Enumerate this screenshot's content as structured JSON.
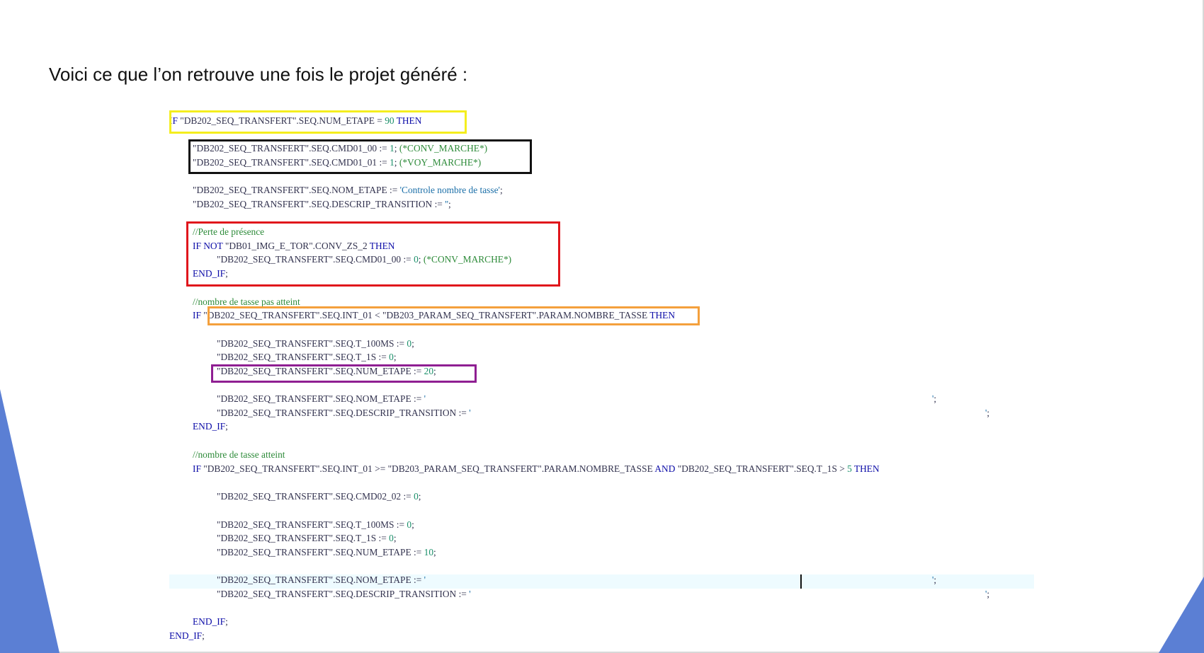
{
  "slide": {
    "intro_text": "Voici ce que l’on retrouve une fois le projet généré :",
    "highlight_colors": {
      "yellow": "#f4ee1e",
      "black": "#111111",
      "red": "#e0161c",
      "orange": "#f4a03c",
      "purple": "#8f1f92"
    },
    "accent_color": "#5b7fd4"
  },
  "code": {
    "lines": [
      {
        "id": "l1",
        "x": 0,
        "y": 0,
        "segments": [
          {
            "t": "IF",
            "c": "kw"
          },
          {
            "t": " \"DB202_SEQ_TRANSFERT\".SEQ.NUM_ETAPE = "
          },
          {
            "t": "90",
            "c": "num"
          },
          {
            "t": " "
          },
          {
            "t": "THEN",
            "c": "kw"
          }
        ]
      },
      {
        "id": "l2",
        "segments": [
          {
            "t": "\"DB202_SEQ_TRANSFERT\".SEQ.CMD01_00 := "
          },
          {
            "t": "1",
            "c": "num"
          },
          {
            "t": "; "
          },
          {
            "t": "(*CONV_MARCHE*)",
            "c": "cmt"
          }
        ]
      },
      {
        "id": "l3",
        "segments": [
          {
            "t": "\"DB202_SEQ_TRANSFERT\".SEQ.CMD01_01 := "
          },
          {
            "t": "1",
            "c": "num"
          },
          {
            "t": "; "
          },
          {
            "t": "(*VOY_MARCHE*)",
            "c": "cmt"
          }
        ]
      },
      {
        "id": "l4",
        "segments": [
          {
            "t": "\"DB202_SEQ_TRANSFERT\".SEQ.NOM_ETAPE := "
          },
          {
            "t": "'Controle nombre de tasse'",
            "c": "str"
          },
          {
            "t": ";"
          }
        ]
      },
      {
        "id": "l5",
        "segments": [
          {
            "t": "\"DB202_SEQ_TRANSFERT\".SEQ.DESCRIP_TRANSITION := "
          },
          {
            "t": "''",
            "c": "str"
          },
          {
            "t": ";"
          }
        ]
      },
      {
        "id": "l6",
        "segments": [
          {
            "t": "//Perte de présence",
            "c": "cmt"
          }
        ]
      },
      {
        "id": "l7",
        "segments": [
          {
            "t": "IF NOT",
            "c": "kw"
          },
          {
            "t": " \"DB01_IMG_E_TOR\".CONV_ZS_2 "
          },
          {
            "t": "THEN",
            "c": "kw"
          }
        ]
      },
      {
        "id": "l8",
        "segments": [
          {
            "t": "\"DB202_SEQ_TRANSFERT\".SEQ.CMD01_00 := "
          },
          {
            "t": "0",
            "c": "num"
          },
          {
            "t": "; "
          },
          {
            "t": "(*CONV_MARCHE*)",
            "c": "cmt"
          }
        ]
      },
      {
        "id": "l9",
        "segments": [
          {
            "t": "END_IF",
            "c": "kw"
          },
          {
            "t": ";"
          }
        ]
      },
      {
        "id": "l10",
        "segments": [
          {
            "t": "//nombre de tasse pas atteint",
            "c": "cmt"
          }
        ]
      },
      {
        "id": "l11",
        "segments": [
          {
            "t": "IF",
            "c": "kw"
          },
          {
            "t": " \"DB202_SEQ_TRANSFERT\".SEQ.INT_01 < \"DB203_PARAM_SEQ_TRANSFERT\".PARAM.NOMBRE_TASSE "
          },
          {
            "t": "THEN",
            "c": "kw"
          }
        ]
      },
      {
        "id": "l12",
        "segments": [
          {
            "t": "\"DB202_SEQ_TRANSFERT\".SEQ.T_100MS := "
          },
          {
            "t": "0",
            "c": "num"
          },
          {
            "t": ";"
          }
        ]
      },
      {
        "id": "l13",
        "segments": [
          {
            "t": "\"DB202_SEQ_TRANSFERT\".SEQ.T_1S := "
          },
          {
            "t": "0",
            "c": "num"
          },
          {
            "t": ";"
          }
        ]
      },
      {
        "id": "l14",
        "segments": [
          {
            "t": "\"DB202_SEQ_TRANSFERT\".SEQ.NUM_ETAPE := "
          },
          {
            "t": "20",
            "c": "num"
          },
          {
            "t": ";"
          }
        ]
      },
      {
        "id": "l15",
        "segments": [
          {
            "t": "\"DB202_SEQ_TRANSFERT\".SEQ.NOM_ETAPE := "
          },
          {
            "t": "'",
            "c": "str"
          }
        ]
      },
      {
        "id": "l15b",
        "segments": [
          {
            "t": "'",
            "c": "str"
          },
          {
            "t": ";"
          }
        ]
      },
      {
        "id": "l16",
        "segments": [
          {
            "t": "\"DB202_SEQ_TRANSFERT\".SEQ.DESCRIP_TRANSITION := "
          },
          {
            "t": "'",
            "c": "str"
          }
        ]
      },
      {
        "id": "l16b",
        "segments": [
          {
            "t": "'",
            "c": "str"
          },
          {
            "t": ";"
          }
        ]
      },
      {
        "id": "l17",
        "segments": [
          {
            "t": "END_IF",
            "c": "kw"
          },
          {
            "t": ";"
          }
        ]
      },
      {
        "id": "l18",
        "segments": [
          {
            "t": "//nombre de tasse atteint",
            "c": "cmt"
          }
        ]
      },
      {
        "id": "l19",
        "segments": [
          {
            "t": "IF",
            "c": "kw"
          },
          {
            "t": " \"DB202_SEQ_TRANSFERT\".SEQ.INT_01 >= \"DB203_PARAM_SEQ_TRANSFERT\".PARAM.NOMBRE_TASSE "
          },
          {
            "t": "AND",
            "c": "kw"
          },
          {
            "t": " \"DB202_SEQ_TRANSFERT\".SEQ.T_1S > "
          },
          {
            "t": "5",
            "c": "num"
          },
          {
            "t": " "
          },
          {
            "t": "THEN",
            "c": "kw"
          }
        ]
      },
      {
        "id": "l20",
        "segments": [
          {
            "t": "\"DB202_SEQ_TRANSFERT\".SEQ.CMD02_02 := "
          },
          {
            "t": "0",
            "c": "num"
          },
          {
            "t": ";"
          }
        ]
      },
      {
        "id": "l21",
        "segments": [
          {
            "t": "\"DB202_SEQ_TRANSFERT\".SEQ.T_100MS := "
          },
          {
            "t": "0",
            "c": "num"
          },
          {
            "t": ";"
          }
        ]
      },
      {
        "id": "l22",
        "segments": [
          {
            "t": "\"DB202_SEQ_TRANSFERT\".SEQ.T_1S := "
          },
          {
            "t": "0",
            "c": "num"
          },
          {
            "t": ";"
          }
        ]
      },
      {
        "id": "l23",
        "segments": [
          {
            "t": "\"DB202_SEQ_TRANSFERT\".SEQ.NUM_ETAPE := "
          },
          {
            "t": "10",
            "c": "num"
          },
          {
            "t": ";"
          }
        ]
      },
      {
        "id": "l24",
        "segments": [
          {
            "t": "\"DB202_SEQ_TRANSFERT\".SEQ.NOM_ETAPE := "
          },
          {
            "t": "'",
            "c": "str"
          }
        ]
      },
      {
        "id": "l24b",
        "segments": [
          {
            "t": "'",
            "c": "str"
          },
          {
            "t": ";"
          }
        ]
      },
      {
        "id": "l25",
        "segments": [
          {
            "t": "\"DB202_SEQ_TRANSFERT\".SEQ.DESCRIP_TRANSITION := "
          },
          {
            "t": "'",
            "c": "str"
          }
        ]
      },
      {
        "id": "l25b",
        "segments": [
          {
            "t": "'",
            "c": "str"
          },
          {
            "t": ";"
          }
        ]
      },
      {
        "id": "l26",
        "segments": [
          {
            "t": "END_IF",
            "c": "kw"
          },
          {
            "t": ";"
          }
        ]
      },
      {
        "id": "l27",
        "segments": [
          {
            "t": "END_IF",
            "c": "kw"
          },
          {
            "t": ";"
          }
        ]
      }
    ]
  }
}
